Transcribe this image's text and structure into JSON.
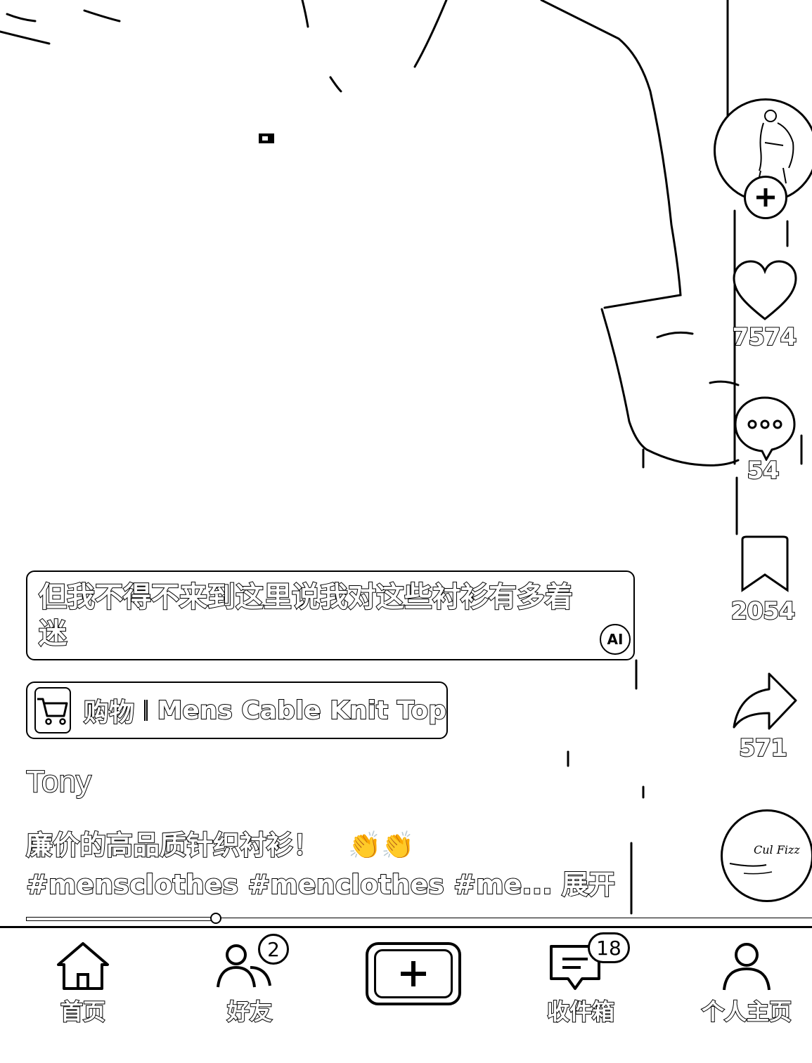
{
  "caption": {
    "text": "但我不得不来到这里说我对这些衬衫有多着迷",
    "ai_badge": "AI"
  },
  "shop": {
    "label": "购物",
    "product": "Mens Cable Knit Top"
  },
  "author": "Tony",
  "description": {
    "line1": "廉价的高品质针织衬衫！",
    "emoji": "👏👏",
    "line2_tags": "#mensclothes #menclothes #me...",
    "expand": "展开"
  },
  "rail": {
    "likes": "7574",
    "comments": "54",
    "saves": "2054",
    "shares": "571",
    "disc_text": "Cul Fizz"
  },
  "progress": {
    "fraction": 0.24
  },
  "nav": {
    "home": "首页",
    "friends": "好友",
    "friends_badge": "2",
    "inbox": "收件箱",
    "inbox_badge": "18",
    "profile": "个人主页"
  }
}
